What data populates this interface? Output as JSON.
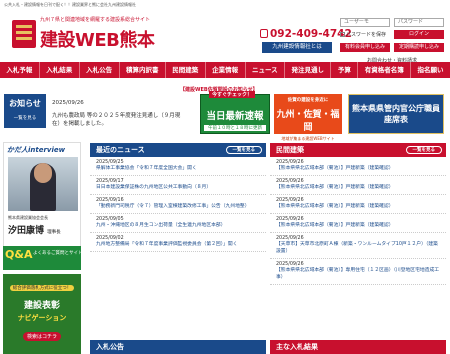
{
  "top_line": "公共入札・建設情報を日刊で配く！！建設業界と熊に会社九州建設情報社",
  "logo": {
    "tagline": "九州７県と関連地域を網羅する建設系総合サイト",
    "title": "建設WEB熊本"
  },
  "contact": {
    "tel": "092-409-4742",
    "kensetsu_button": "九州建設情報社とは"
  },
  "login": {
    "user_placeholder": "ユーザーモ",
    "password_placeholder": "パスワード",
    "save_password": "パスワードを保存",
    "login_button": "ログイン",
    "register_button": "有料会員申し込み",
    "trial_button": "定期購読申し込み",
    "inquiry": "お問合わせ・資料請求"
  },
  "nav": [
    "入札予報",
    "入札結果",
    "入札公告",
    "積算内訳書",
    "民間建築",
    "企業情報",
    "ニュース",
    "発注見通し",
    "予算",
    "有資格者名簿",
    "指名願い"
  ],
  "notice": {
    "heading": "お知らせ",
    "more": "一覧を見る",
    "date": "2025/09/26",
    "text": "九州も農政局 等の２０２５年度発注見通し（９月現在）を掲載しました。"
  },
  "banners": {
    "caption": "【建設WEB佐賀開設のお知らせ】",
    "b1_top": "今すぐチェック！",
    "b1_main": "当日最新速報",
    "b1_sub": "午前１０時と１８時に更新",
    "b2_top": "佐賀の建設を身近に",
    "b2_main": "九州・佐賀・福岡",
    "b2_sub": "地域が集まる建設WEBサイト",
    "b3_main": "熊本県県管内官公庁職員座席表"
  },
  "interview": {
    "title": "かだ人interview",
    "caption": "熊本県建設業協会会長",
    "name": "汐田康博",
    "suffix": "理事長"
  },
  "qa": {
    "mark": "Q&A",
    "text": "よくあるご質問とサイトの使い方"
  },
  "hyosho": {
    "top": "総合評価落札方式に役立つ！",
    "main": "建設表彰",
    "sub": "ナビゲーション",
    "cta": "検索はコチラ"
  },
  "news_panel": {
    "title": "最近のニュース",
    "more": "一覧を見る",
    "items": [
      {
        "date": "2025/09/25",
        "title": "県解体工事業協会「令和７年度全国大会」開く"
      },
      {
        "date": "2025/09/17",
        "title": "日日本建設業保証株の九州地区公共工事動向（８月）"
      },
      {
        "date": "2025/09/16",
        "title": "「勤務新門司税庁（令７）管理入室棟建築改修工事」公告（九州地整）"
      },
      {
        "date": "2025/09/05",
        "title": "九州・沖縄地区の８月生コン出荷量（全生連九州地区本部）"
      },
      {
        "date": "2025/09/02",
        "title": "九州地方整備局「令和７年度事業評価監視委員会（第２回）」開く"
      }
    ]
  },
  "private_panel": {
    "title": "民間建築",
    "more": "一覧を見る",
    "items": [
      {
        "date": "2025/09/26",
        "title": "【熊本県県北広域本部（菊池）】戸建新築（建築確認）"
      },
      {
        "date": "2025/09/26",
        "title": "【熊本県県北広域本部（菊池）】戸建新築（建築確認）"
      },
      {
        "date": "2025/09/26",
        "title": "【熊本県県北広域本部（菊池）】戸建新築（建築確認）"
      },
      {
        "date": "2025/09/26",
        "title": "【熊本県県北広域本部（菊池）】戸建新築（建築確認）"
      },
      {
        "date": "2025/09/26",
        "title": "【天草市】天草市北原町Ａ棟（新築・ワンルームタイプ10戸１２户）（建築設置）"
      },
      {
        "date": "2025/09/26",
        "title": "【熊本県県北広域本部（菊池）】専用住宅（１２区画）（川登地区宅地造成工事）"
      }
    ]
  },
  "bottom": {
    "left": "入札公告",
    "right": "主な入札結果"
  },
  "colors": {
    "brand_red": "#c8102e",
    "brand_blue": "#1a4a8a"
  }
}
